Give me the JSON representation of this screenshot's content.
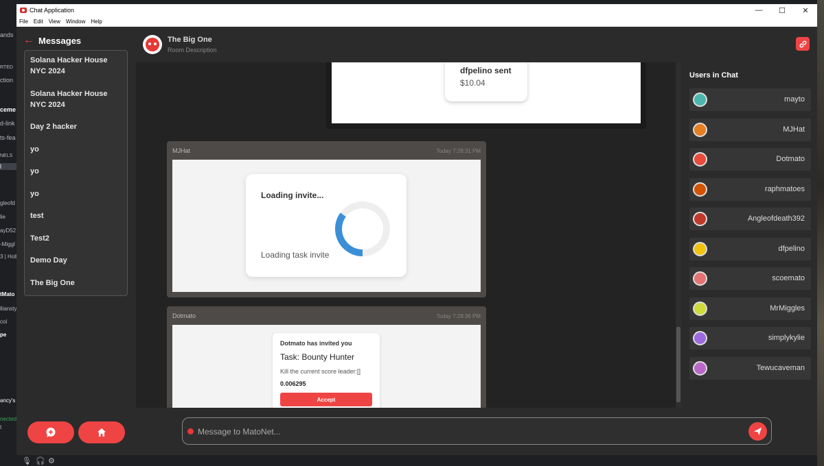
{
  "background": {
    "left_fragments": [
      "ands",
      "RTED",
      "ction",
      "ceme",
      "d-link",
      "ts-fea",
      "NELS",
      "l",
      "gleofd",
      "lie",
      "ayD52",
      "-Miggl",
      "3 | Holl",
      "tMato",
      "lliansty",
      "col",
      "pe",
      "ancy's",
      "nected",
      "t"
    ]
  },
  "window": {
    "title": "Chat Application",
    "controls": [
      "—",
      "☐",
      "✕"
    ],
    "menu": [
      "File",
      "Edit",
      "View",
      "Window",
      "Help"
    ]
  },
  "sidebar": {
    "title": "Messages",
    "rooms": [
      "Solana Hacker House NYC 2024",
      "Solana Hacker House NYC 2024",
      "Day 2 hacker",
      "yo",
      "yo",
      "yo",
      "test",
      "Test2",
      "Demo Day",
      "The Big One"
    ],
    "buttons": {
      "new_chat_icon": "chat-plus-icon",
      "home_icon": "home-icon"
    }
  },
  "header": {
    "room_name": "The Big One",
    "room_description": "Room Description"
  },
  "messages": [
    {
      "card_title": "dfpelino sent",
      "card_amount": "$10.04"
    },
    {
      "author": "MJHat",
      "time": "Today 7:28:31 PM",
      "loading_title": "Loading invite...",
      "loading_text": "Loading task invite",
      "loading_progress": 0.35
    },
    {
      "author": "Dotmato",
      "time": "Today 7:28:36 PM",
      "invite_from": "Dotmato has invited you",
      "task_title": "Task: Bounty Hunter",
      "task_desc": "Kill the current score leader:[]",
      "amount": "0.006295",
      "accept_label": "Accept"
    }
  ],
  "composer": {
    "placeholder": "Message to MatoNet..."
  },
  "users": {
    "title": "Users in Chat",
    "list": [
      {
        "name": "mayto",
        "color": "#4db6ac"
      },
      {
        "name": "MJHat",
        "color": "#e67e22"
      },
      {
        "name": "Dotmato",
        "color": "#e74c3c"
      },
      {
        "name": "raphmatoes",
        "color": "#d35400"
      },
      {
        "name": "Angleofdeath392",
        "color": "#c0392b"
      },
      {
        "name": "dfpelino",
        "color": "#f1c40f"
      },
      {
        "name": "scoemato",
        "color": "#e57373"
      },
      {
        "name": "MrMiggles",
        "color": "#cddc39"
      },
      {
        "name": "simplykylie",
        "color": "#9c6ade"
      },
      {
        "name": "Tewucaveman",
        "color": "#ba68c8"
      }
    ]
  },
  "colors": {
    "accent": "#ef4444",
    "panel": "#2b2b2b",
    "chat_bg": "#232323"
  }
}
